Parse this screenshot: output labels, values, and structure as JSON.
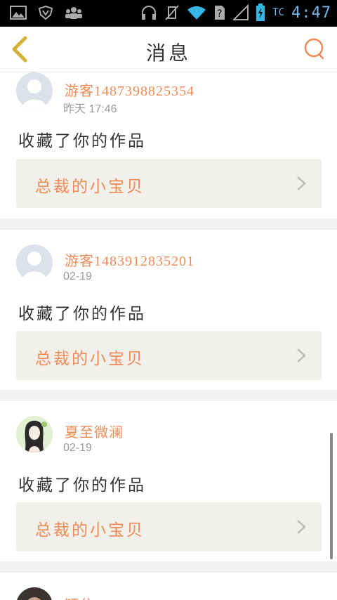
{
  "status_bar": {
    "carrier": "TC",
    "time": "4:47",
    "icons": [
      "image-icon",
      "vpn-shield-icon",
      "users-icon",
      "headset-icon",
      "mute-icon",
      "wifi-icon",
      "sim-question-icon",
      "signal-icon",
      "battery-icon"
    ]
  },
  "header": {
    "title": "消息",
    "back_icon": "chevron-left-icon",
    "search_icon": "search-icon"
  },
  "colors": {
    "accent": "#f28a55",
    "back_arrow": "#d4b33b",
    "card_link_bg": "#f1f0ea",
    "page_bg": "#f2f2f2"
  },
  "messages": [
    {
      "username": "游客1487398825354",
      "timestamp": "昨天 17:46",
      "action": "收藏了你的作品",
      "work_title": "总裁的小宝贝",
      "avatar": "default-avatar"
    },
    {
      "username": "游客1483912835201",
      "timestamp": "02-19",
      "action": "收藏了你的作品",
      "work_title": "总裁的小宝贝",
      "avatar": "default-avatar"
    },
    {
      "username": "夏至微澜",
      "timestamp": "02-19",
      "action": "收藏了你的作品",
      "work_title": "总裁的小宝贝",
      "avatar": "illustrated-girl-avatar"
    },
    {
      "username": "颖兮",
      "avatar": "photo-avatar"
    }
  ]
}
